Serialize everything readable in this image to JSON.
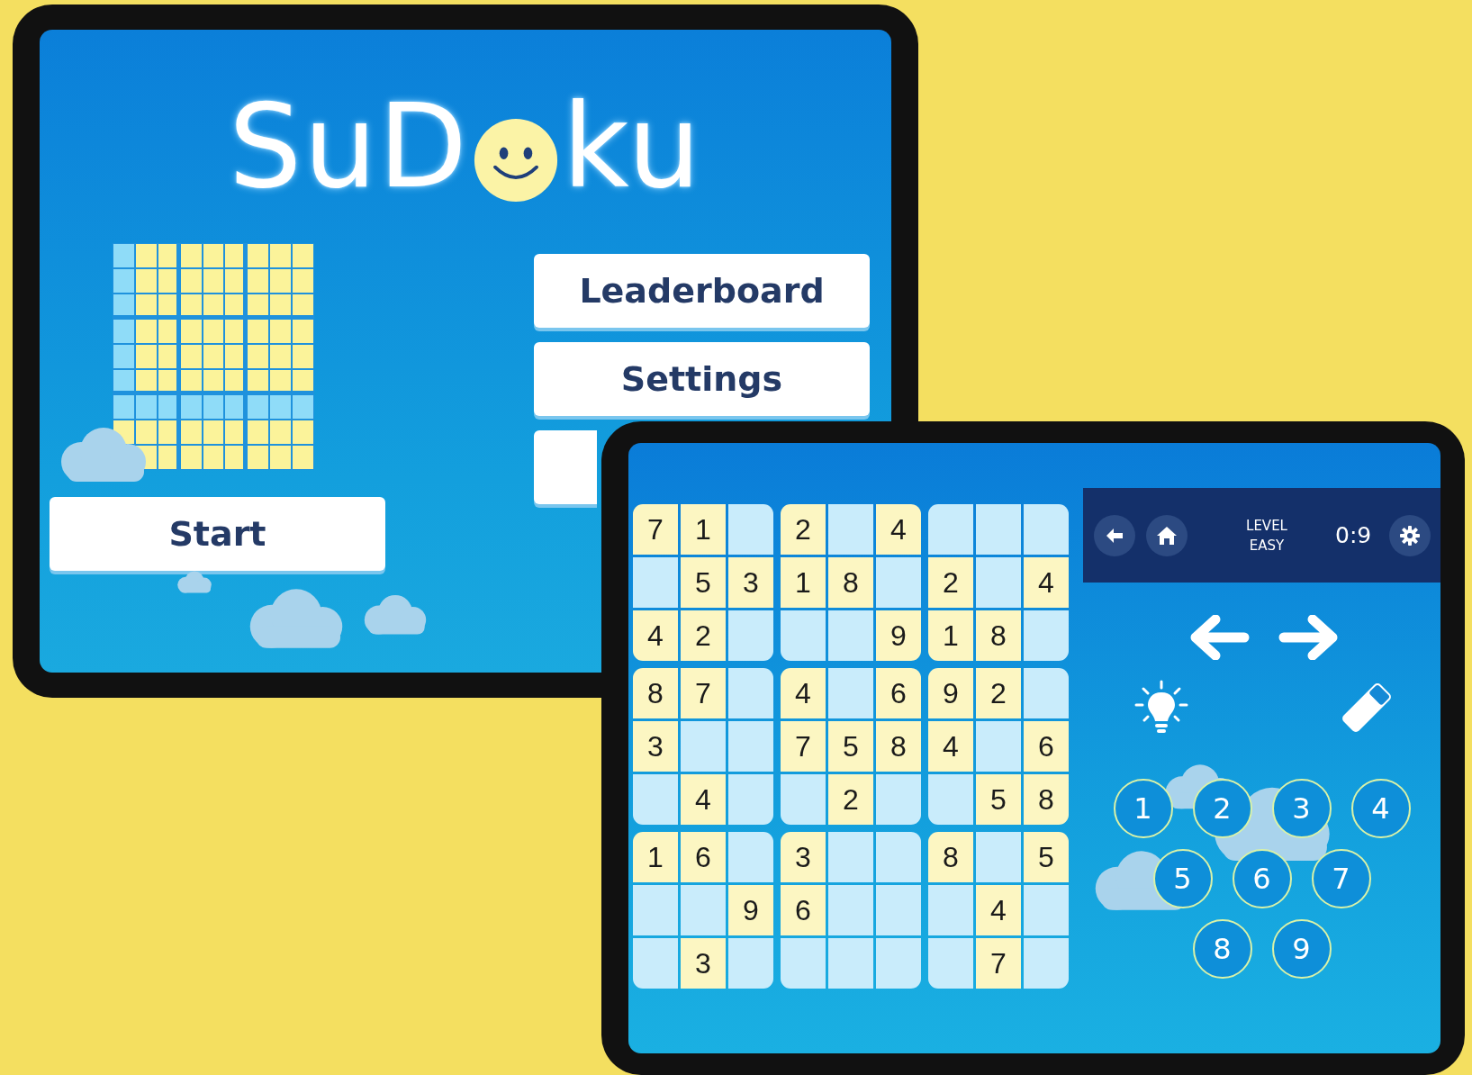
{
  "home_screen": {
    "logo": {
      "before": "SuD",
      "after": "ku"
    },
    "menu_buttons": [
      "Leaderboard",
      "Settings"
    ],
    "start_button": "Start"
  },
  "game_screen": {
    "toolbar": {
      "level_label": "LEVEL",
      "level_value": "EASY",
      "timer": "0:9"
    },
    "puzzle": {
      "rows": [
        [
          {
            "value": "7",
            "given": true
          },
          {
            "value": "1",
            "given": true
          },
          {
            "given": false
          },
          {
            "value": "2",
            "given": true
          },
          {
            "given": false
          },
          {
            "value": "4",
            "given": true
          },
          {
            "given": false
          },
          {
            "given": false
          },
          {
            "given": false
          }
        ],
        [
          {
            "given": false
          },
          {
            "value": "5",
            "given": true
          },
          {
            "value": "3",
            "given": true
          },
          {
            "value": "1",
            "given": true
          },
          {
            "value": "8",
            "given": true
          },
          {
            "given": false
          },
          {
            "value": "2",
            "given": true
          },
          {
            "given": false
          },
          {
            "value": "4",
            "given": true
          }
        ],
        [
          {
            "value": "4",
            "given": true
          },
          {
            "value": "2",
            "given": true
          },
          {
            "given": false
          },
          {
            "given": false
          },
          {
            "given": false
          },
          {
            "value": "9",
            "given": true
          },
          {
            "value": "1",
            "given": true
          },
          {
            "value": "8",
            "given": true
          },
          {
            "given": false
          }
        ],
        [
          {
            "value": "8",
            "given": true
          },
          {
            "value": "7",
            "given": true
          },
          {
            "given": false
          },
          {
            "value": "4",
            "given": true
          },
          {
            "given": false
          },
          {
            "value": "6",
            "given": true
          },
          {
            "value": "9",
            "given": true
          },
          {
            "value": "2",
            "given": true
          },
          {
            "given": false
          }
        ],
        [
          {
            "value": "3",
            "given": true
          },
          {
            "given": false
          },
          {
            "given": false
          },
          {
            "value": "7",
            "given": true
          },
          {
            "value": "5",
            "given": true
          },
          {
            "value": "8",
            "given": true
          },
          {
            "value": "4",
            "given": true
          },
          {
            "given": false
          },
          {
            "value": "6",
            "given": true
          }
        ],
        [
          {
            "given": false
          },
          {
            "value": "4",
            "given": true
          },
          {
            "given": false
          },
          {
            "given": false
          },
          {
            "value": "2",
            "given": true
          },
          {
            "given": false
          },
          {
            "given": false
          },
          {
            "value": "5",
            "given": true
          },
          {
            "value": "8",
            "given": true
          }
        ],
        [
          {
            "value": "1",
            "given": true
          },
          {
            "value": "6",
            "given": true
          },
          {
            "given": false
          },
          {
            "value": "3",
            "given": true
          },
          {
            "given": false
          },
          {
            "given": false
          },
          {
            "value": "8",
            "given": true
          },
          {
            "given": false
          },
          {
            "value": "5",
            "given": true
          }
        ],
        [
          {
            "given": false
          },
          {
            "given": false
          },
          {
            "value": "9",
            "given": true
          },
          {
            "value": "6",
            "given": true
          },
          {
            "given": false
          },
          {
            "given": false
          },
          {
            "given": false
          },
          {
            "value": "4",
            "given": true
          },
          {
            "given": false
          }
        ],
        [
          {
            "given": false
          },
          {
            "value": "3",
            "given": true
          },
          {
            "given": false
          },
          {
            "given": false
          },
          {
            "given": false
          },
          {
            "given": false
          },
          {
            "given": false
          },
          {
            "value": "7",
            "given": true
          },
          {
            "given": false
          }
        ]
      ]
    },
    "keypad": [
      [
        "1",
        "2",
        "3",
        "4"
      ],
      [
        "5",
        "6",
        "7"
      ],
      [
        "8",
        "9"
      ]
    ]
  }
}
